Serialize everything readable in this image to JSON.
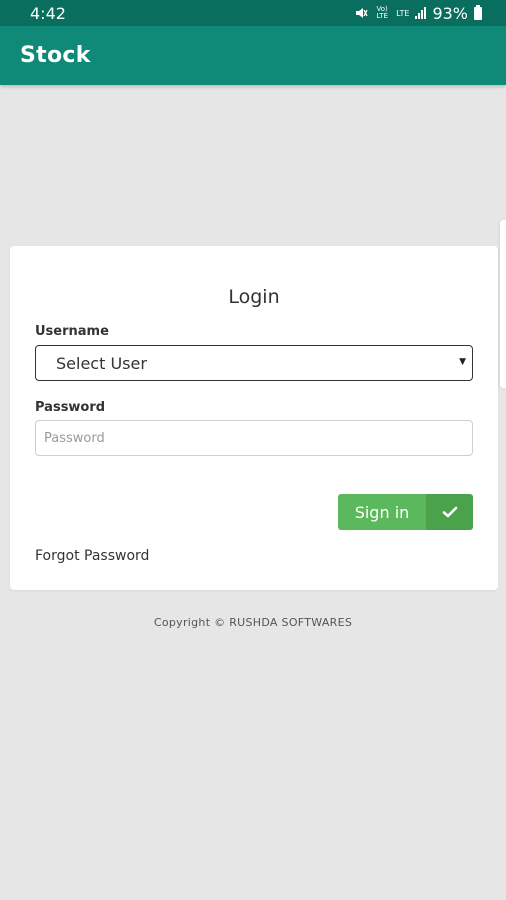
{
  "status_bar": {
    "time": "4:42",
    "battery": "93%",
    "icons": [
      "mute-icon",
      "volte-icon",
      "lte-icon",
      "signal-icon",
      "battery-icon"
    ],
    "vo_lte": "Vo) LTE",
    "lte": "LTE"
  },
  "app_bar": {
    "title": "Stock"
  },
  "login": {
    "title": "Login",
    "username_label": "Username",
    "user_select_value": "Select User",
    "password_label": "Password",
    "password_placeholder": "Password",
    "signin_label": "Sign in",
    "forgot_label": "Forgot Password"
  },
  "footer": {
    "copyright": "Copyright © RUSHDA SOFTWARES"
  },
  "colors": {
    "status_bar": "#0a6e5e",
    "app_bar": "#0f8a78",
    "background": "#e6e6e6",
    "signin": "#5cb85c",
    "signin_icon_bg": "#4aa34a"
  }
}
